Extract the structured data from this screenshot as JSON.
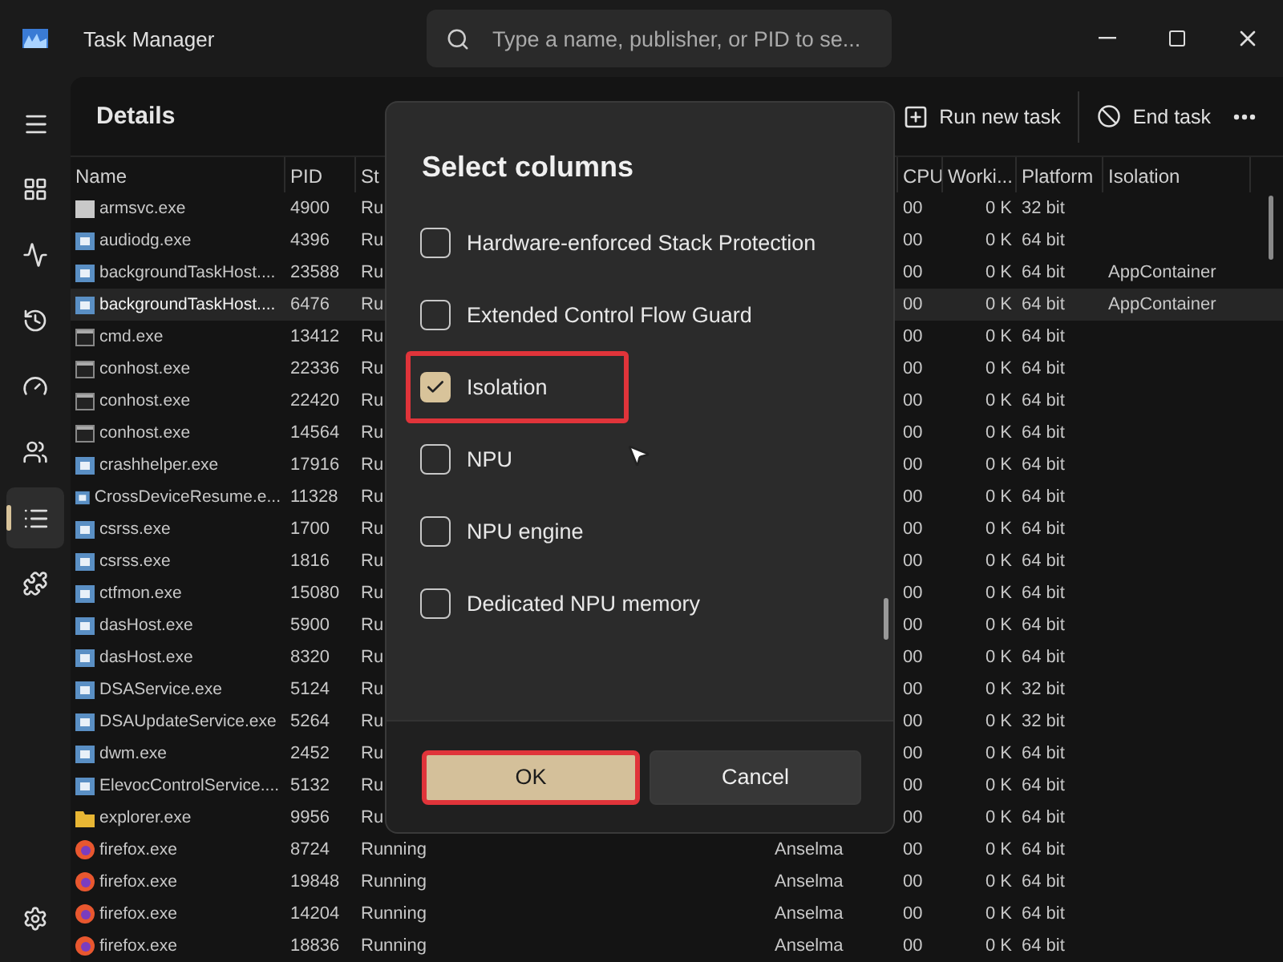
{
  "window": {
    "title": "Task Manager"
  },
  "search": {
    "placeholder": "Type a name, publisher, or PID to se..."
  },
  "nav": [
    {
      "selected": false
    },
    {
      "selected": false
    },
    {
      "selected": false
    },
    {
      "selected": false
    },
    {
      "selected": false
    },
    {
      "selected": false
    },
    {
      "selected": true
    },
    {
      "selected": false
    }
  ],
  "page_title": "Details",
  "toolbar": [
    "Run new task",
    "End task"
  ],
  "table": {
    "columns": [
      "Name",
      "PID",
      "St",
      "",
      "CPU",
      "Worki...",
      "Platform",
      "Isolation"
    ],
    "rows": [
      {
        "kind": "blank",
        "name": "armsvc.exe",
        "pid": "4900",
        "status": "Ru",
        "cpu": "00",
        "mem": "0 K",
        "platform": "32 bit",
        "selected": false
      },
      {
        "kind": "app",
        "name": "audiodg.exe",
        "pid": "4396",
        "status": "Ru",
        "cpu": "00",
        "mem": "0 K",
        "platform": "64 bit",
        "selected": false
      },
      {
        "kind": "app",
        "name": "backgroundTaskHost....",
        "pid": "23588",
        "status": "Ru",
        "cpu": "00",
        "mem": "0 K",
        "platform": "64 bit",
        "isolation": "AppContainer",
        "selected": false
      },
      {
        "kind": "app",
        "name": "backgroundTaskHost....",
        "pid": "6476",
        "status": "Ru",
        "cpu": "00",
        "mem": "0 K",
        "platform": "64 bit",
        "isolation": "AppContainer",
        "selected": true
      },
      {
        "kind": "console",
        "name": "cmd.exe",
        "pid": "13412",
        "status": "Ru",
        "cpu": "00",
        "mem": "0 K",
        "platform": "64 bit",
        "selected": false
      },
      {
        "kind": "console",
        "name": "conhost.exe",
        "pid": "22336",
        "status": "Ru",
        "cpu": "00",
        "mem": "0 K",
        "platform": "64 bit",
        "selected": false
      },
      {
        "kind": "console",
        "name": "conhost.exe",
        "pid": "22420",
        "status": "Ru",
        "cpu": "00",
        "mem": "0 K",
        "platform": "64 bit",
        "selected": false
      },
      {
        "kind": "console",
        "name": "conhost.exe",
        "pid": "14564",
        "status": "Ru",
        "cpu": "00",
        "mem": "0 K",
        "platform": "64 bit",
        "selected": false
      },
      {
        "kind": "app",
        "name": "crashhelper.exe",
        "pid": "17916",
        "status": "Ru",
        "cpu": "00",
        "mem": "0 K",
        "platform": "64 bit",
        "selected": false
      },
      {
        "kind": "app",
        "name": "CrossDeviceResume.e...",
        "pid": "11328",
        "status": "Ru",
        "cpu": "00",
        "mem": "0 K",
        "platform": "64 bit",
        "selected": false
      },
      {
        "kind": "app",
        "name": "csrss.exe",
        "pid": "1700",
        "status": "Ru",
        "cpu": "00",
        "mem": "0 K",
        "platform": "64 bit",
        "selected": false
      },
      {
        "kind": "app",
        "name": "csrss.exe",
        "pid": "1816",
        "status": "Ru",
        "cpu": "00",
        "mem": "0 K",
        "platform": "64 bit",
        "selected": false
      },
      {
        "kind": "app",
        "name": "ctfmon.exe",
        "pid": "15080",
        "status": "Ru",
        "cpu": "00",
        "mem": "0 K",
        "platform": "64 bit",
        "selected": false
      },
      {
        "kind": "app",
        "name": "dasHost.exe",
        "pid": "5900",
        "status": "Ru",
        "cpu": "00",
        "mem": "0 K",
        "platform": "64 bit",
        "selected": false
      },
      {
        "kind": "app",
        "name": "dasHost.exe",
        "pid": "8320",
        "status": "Ru",
        "cpu": "00",
        "mem": "0 K",
        "platform": "64 bit",
        "selected": false
      },
      {
        "kind": "app",
        "name": "DSAService.exe",
        "pid": "5124",
        "status": "Ru",
        "cpu": "00",
        "mem": "0 K",
        "platform": "32 bit",
        "selected": false
      },
      {
        "kind": "app",
        "name": "DSAUpdateService.exe",
        "pid": "5264",
        "status": "Ru",
        "cpu": "00",
        "mem": "0 K",
        "platform": "32 bit",
        "selected": false
      },
      {
        "kind": "app",
        "name": "dwm.exe",
        "pid": "2452",
        "status": "Ru",
        "cpu": "00",
        "mem": "0 K",
        "platform": "64 bit",
        "selected": false
      },
      {
        "kind": "app",
        "name": "ElevocControlService....",
        "pid": "5132",
        "status": "Ru",
        "cpu": "00",
        "mem": "0 K",
        "platform": "64 bit",
        "selected": false
      },
      {
        "kind": "folder",
        "name": "explorer.exe",
        "pid": "9956",
        "status": "Ru",
        "cpu": "00",
        "mem": "0 K",
        "platform": "64 bit",
        "selected": false
      },
      {
        "kind": "firefox",
        "name": "firefox.exe",
        "pid": "8724",
        "status": "Running",
        "user": "Anselma",
        "cpu": "00",
        "mem": "0 K",
        "platform": "64 bit",
        "selected": false
      },
      {
        "kind": "firefox",
        "name": "firefox.exe",
        "pid": "19848",
        "status": "Running",
        "user": "Anselma",
        "cpu": "00",
        "mem": "0 K",
        "platform": "64 bit",
        "selected": false
      },
      {
        "kind": "firefox",
        "name": "firefox.exe",
        "pid": "14204",
        "status": "Running",
        "user": "Anselma",
        "cpu": "00",
        "mem": "0 K",
        "platform": "64 bit",
        "selected": false
      },
      {
        "kind": "firefox",
        "name": "firefox.exe",
        "pid": "18836",
        "status": "Running",
        "user": "Anselma",
        "cpu": "00",
        "mem": "0 K",
        "platform": "64 bit",
        "selected": false
      }
    ]
  },
  "dialog": {
    "title": "Select columns",
    "options": [
      {
        "label": "Hardware-enforced Stack Protection",
        "checked": false,
        "highlighted": false
      },
      {
        "label": "Extended Control Flow Guard",
        "checked": false,
        "highlighted": false
      },
      {
        "label": "Isolation",
        "checked": true,
        "highlighted": true
      },
      {
        "label": "NPU",
        "checked": false,
        "highlighted": false
      },
      {
        "label": "NPU engine",
        "checked": false,
        "highlighted": false
      },
      {
        "label": "Dedicated NPU memory",
        "checked": false,
        "highlighted": false
      }
    ],
    "buttons": [
      {
        "label": "OK",
        "primary": true,
        "highlighted": true
      },
      {
        "label": "Cancel",
        "primary": false,
        "highlighted": false
      }
    ]
  }
}
